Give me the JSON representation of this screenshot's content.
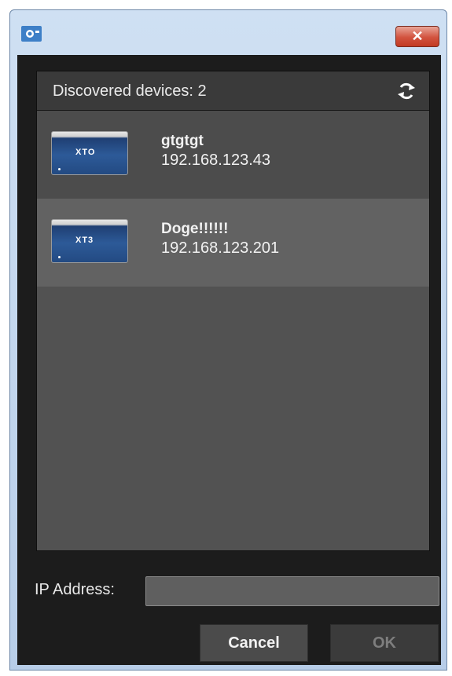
{
  "window": {
    "close_label": "✕"
  },
  "panel": {
    "title": "Discovered devices: 2"
  },
  "devices": [
    {
      "name": "gtgtgt",
      "ip": "192.168.123.43",
      "badge": "XTO"
    },
    {
      "name": "Doge!!!!!!",
      "ip": "192.168.123.201",
      "badge": "XT3"
    }
  ],
  "form": {
    "ip_label": "IP Address:",
    "ip_value": ""
  },
  "buttons": {
    "cancel": "Cancel",
    "ok": "OK"
  },
  "colors": {
    "accent_close": "#c23a22",
    "panel_bg": "#525252",
    "selected_row": "#626262"
  }
}
